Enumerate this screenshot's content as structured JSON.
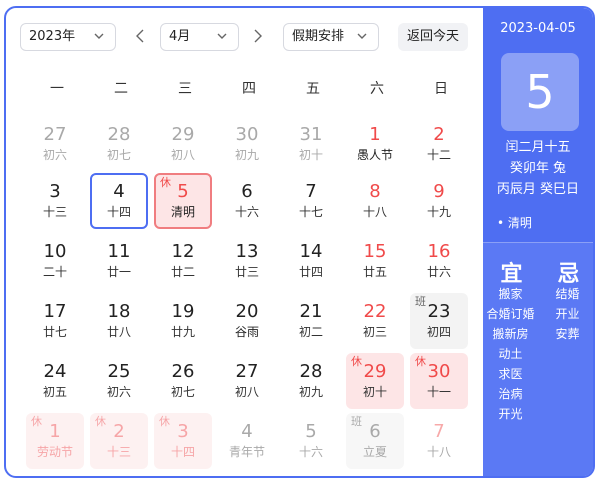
{
  "toolbar": {
    "year_value": "2023年",
    "month_value": "4月",
    "holiday_value": "假期安排",
    "today_label": "返回今天"
  },
  "weekdays": [
    "一",
    "二",
    "三",
    "四",
    "五",
    "六",
    "日"
  ],
  "weeks": [
    [
      {
        "num": "27",
        "sub": "初六",
        "other": true
      },
      {
        "num": "28",
        "sub": "初七",
        "other": true
      },
      {
        "num": "29",
        "sub": "初八",
        "other": true
      },
      {
        "num": "30",
        "sub": "初九",
        "other": true
      },
      {
        "num": "31",
        "sub": "初十",
        "other": true
      },
      {
        "num": "1",
        "sub": "愚人节",
        "weekend": true,
        "festival": true
      },
      {
        "num": "2",
        "sub": "十二",
        "weekend": true
      }
    ],
    [
      {
        "num": "3",
        "sub": "十三"
      },
      {
        "num": "4",
        "sub": "十四",
        "selected": true
      },
      {
        "num": "5",
        "sub": "清明",
        "badge": "休",
        "today": true,
        "festival": true
      },
      {
        "num": "6",
        "sub": "十六"
      },
      {
        "num": "7",
        "sub": "十七"
      },
      {
        "num": "8",
        "sub": "十八",
        "weekend": true
      },
      {
        "num": "9",
        "sub": "十九",
        "weekend": true
      }
    ],
    [
      {
        "num": "10",
        "sub": "二十"
      },
      {
        "num": "11",
        "sub": "廿一"
      },
      {
        "num": "12",
        "sub": "廿二"
      },
      {
        "num": "13",
        "sub": "廿三"
      },
      {
        "num": "14",
        "sub": "廿四"
      },
      {
        "num": "15",
        "sub": "廿五",
        "weekend": true
      },
      {
        "num": "16",
        "sub": "廿六",
        "weekend": true
      }
    ],
    [
      {
        "num": "17",
        "sub": "廿七"
      },
      {
        "num": "18",
        "sub": "廿八"
      },
      {
        "num": "19",
        "sub": "廿九"
      },
      {
        "num": "20",
        "sub": "谷雨",
        "festival": true
      },
      {
        "num": "21",
        "sub": "初二"
      },
      {
        "num": "22",
        "sub": "初三",
        "weekend": true
      },
      {
        "num": "23",
        "sub": "初四",
        "badge": "班",
        "work": true
      }
    ],
    [
      {
        "num": "24",
        "sub": "初五"
      },
      {
        "num": "25",
        "sub": "初六"
      },
      {
        "num": "26",
        "sub": "初七"
      },
      {
        "num": "27",
        "sub": "初八"
      },
      {
        "num": "28",
        "sub": "初九"
      },
      {
        "num": "29",
        "sub": "初十",
        "badge": "休",
        "rest": true
      },
      {
        "num": "30",
        "sub": "十一",
        "badge": "休",
        "rest": true
      }
    ],
    [
      {
        "num": "1",
        "sub": "劳动节",
        "badge": "休",
        "rest": true,
        "other": true
      },
      {
        "num": "2",
        "sub": "十三",
        "badge": "休",
        "rest": true,
        "other": true
      },
      {
        "num": "3",
        "sub": "十四",
        "badge": "休",
        "rest": true,
        "other": true
      },
      {
        "num": "4",
        "sub": "青年节",
        "other": true
      },
      {
        "num": "5",
        "sub": "十六",
        "other": true
      },
      {
        "num": "6",
        "sub": "立夏",
        "badge": "班",
        "work": true,
        "other": true
      },
      {
        "num": "7",
        "sub": "十八",
        "other": true,
        "weekend": true
      }
    ]
  ],
  "side": {
    "date": "2023-04-05",
    "day": "5",
    "lunar_line1": "闰二月十五",
    "lunar_line2": "癸卯年 兔",
    "lunar_line3": "丙辰月 癸巳日",
    "term": "• 清明",
    "yi_label": "宜",
    "ji_label": "忌",
    "yi_items": [
      "搬家",
      "合婚订婚",
      "搬新房",
      "动土",
      "求医",
      "治病",
      "开光"
    ],
    "ji_items": [
      "结婚",
      "开业",
      "安葬"
    ]
  },
  "colors": {
    "accent": "#4e6ef2",
    "holiday_red": "#f04a4a",
    "rest_bg": "#fde5e6"
  }
}
